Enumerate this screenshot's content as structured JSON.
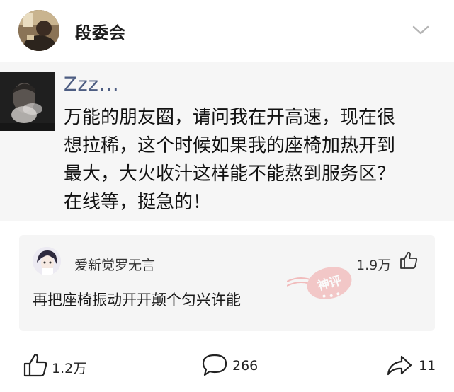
{
  "header": {
    "author_name": "段委会"
  },
  "moment": {
    "user": "Zzz...",
    "lines": [
      "万能的朋友圈，请问我在开高速，现在很",
      "想拉稀，这个时候如果我的座椅加热开到",
      "最大，大火收汁这样能不能熬到服务区？",
      "在线等，挺急的！"
    ]
  },
  "hot_comment": {
    "user": "爱新觉罗无言",
    "likes": "1.9万",
    "text": "再把座椅振动开开颠个匀兴许能",
    "stamp_text": "神评"
  },
  "actions": {
    "like_count": "1.2万",
    "comment_count": "266",
    "share_count": "11"
  }
}
